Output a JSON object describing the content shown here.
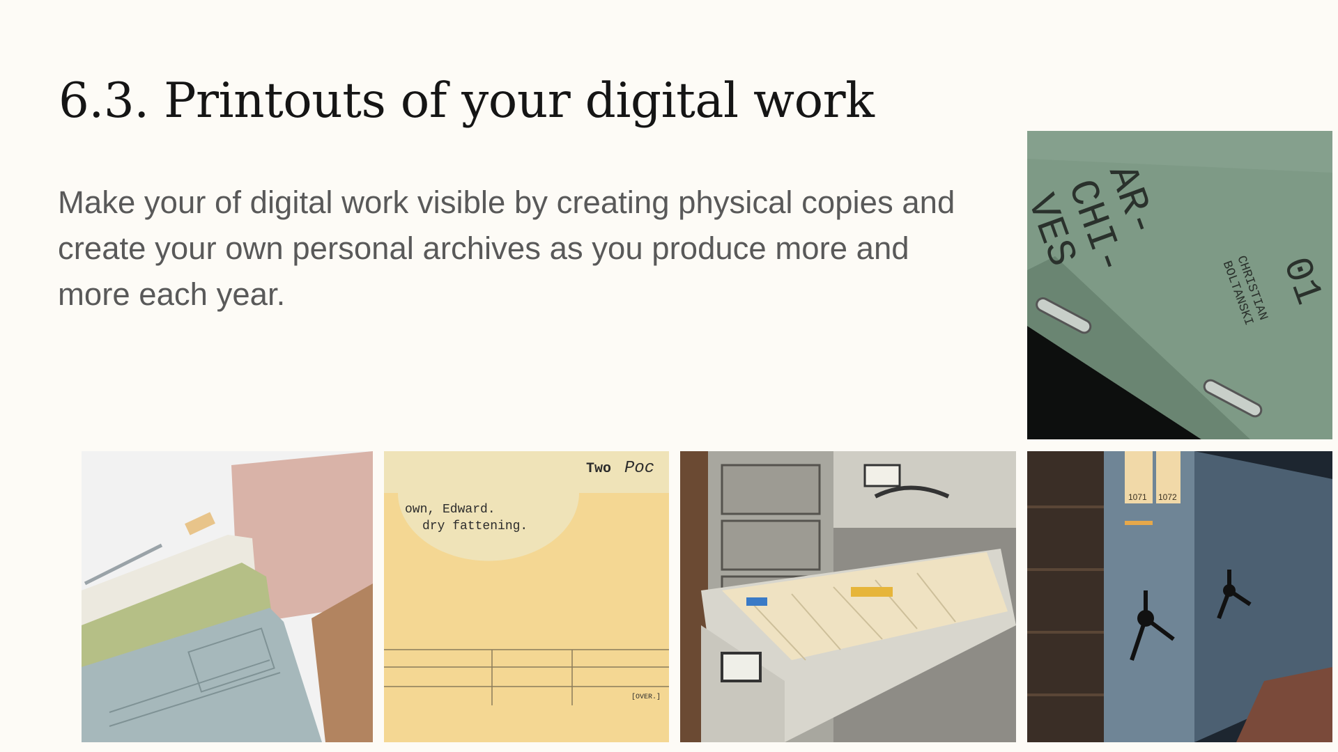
{
  "slide": {
    "title": "6.3. Printouts of your digital work",
    "body": "Make your of digital work visible by creating physical copies and create your own personal archives as you produce more and more each year."
  },
  "images": {
    "archives_book": {
      "cover_lines": [
        "AR-",
        "CHI-",
        "VES"
      ],
      "author_lines": [
        "CHRISTIAN",
        "BOLTANSKI"
      ],
      "volume": "01"
    },
    "index_card": {
      "text_lines": [
        "own, Edward.",
        "dry fattening.",
        "Two",
        "Poc",
        "[OVER.]"
      ]
    },
    "shelves": {
      "labels": [
        "1071",
        "1072"
      ]
    }
  },
  "colors": {
    "background": "#fdfbf6",
    "title": "#151515",
    "body_text": "#595959"
  }
}
